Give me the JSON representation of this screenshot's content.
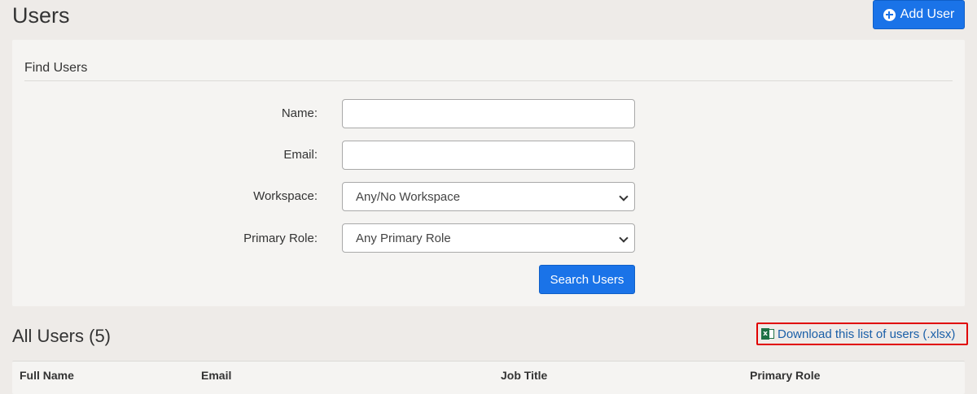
{
  "header": {
    "title": "Users",
    "add_user_label": "Add User"
  },
  "find_panel": {
    "title": "Find Users",
    "name_label": "Name:",
    "name_value": "",
    "email_label": "Email:",
    "email_value": "",
    "workspace_label": "Workspace:",
    "workspace_selected": "Any/No Workspace",
    "role_label": "Primary Role:",
    "role_selected": "Any Primary Role",
    "search_label": "Search Users"
  },
  "results": {
    "title": "All Users (5)",
    "download_label": "Download this list of users (.xlsx)",
    "columns": [
      "Full Name",
      "Email",
      "Job Title",
      "Primary Role"
    ]
  },
  "colors": {
    "primary": "#1a73e8",
    "link": "#1a5fa8",
    "highlight": "#e00000",
    "excel": "#1e7145"
  }
}
